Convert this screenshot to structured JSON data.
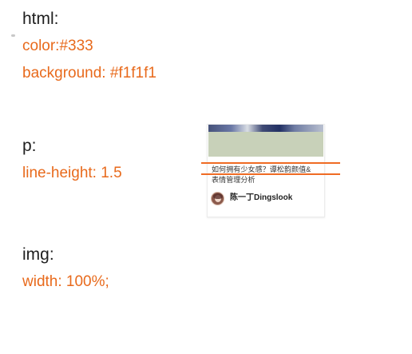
{
  "slide": {
    "rules": [
      {
        "selector": "html:",
        "declarations": [
          "color:#333",
          "background: #f1f1f1"
        ]
      },
      {
        "selector": "p:",
        "declarations": [
          "line-height: 1.5"
        ]
      },
      {
        "selector": "img:",
        "declarations": [
          "width: 100%;"
        ]
      }
    ],
    "accent_color": "#e86a1c"
  },
  "card": {
    "title_line1": "如何拥有少女感？谭松韵颜值&",
    "title_line2": "表情管理分析",
    "author_name": "陈一丁Dingslook"
  }
}
